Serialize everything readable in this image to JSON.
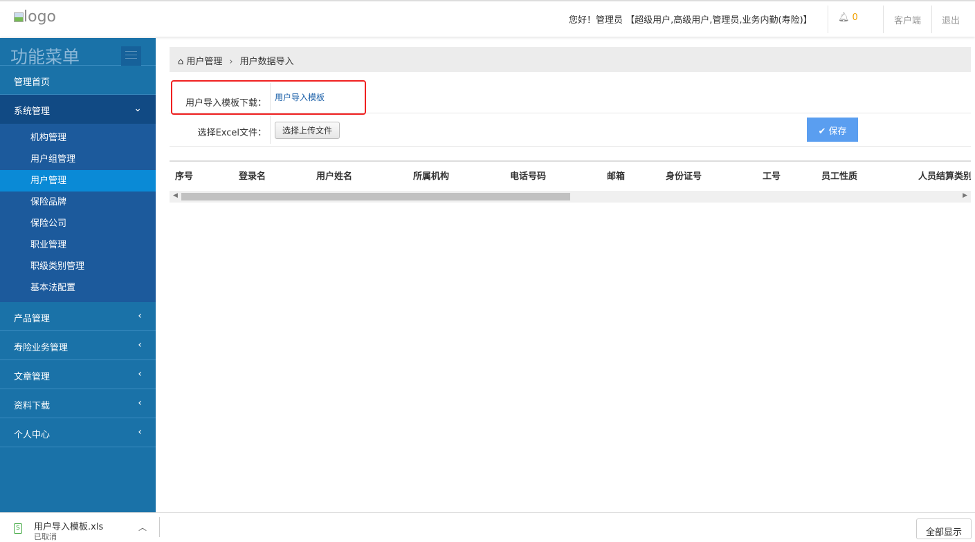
{
  "header": {
    "logo_alt": "logo",
    "greeting": "您好！管理员 【超级用户,高级用户,管理员,业务内勤(寿险)】",
    "notification_count": "0",
    "client_link": "客户端",
    "logout_link": "退出"
  },
  "sidebar": {
    "title": "功能菜单",
    "items": [
      {
        "label": "管理首页"
      },
      {
        "label": "系统管理",
        "children": [
          "机构管理",
          "用户组管理",
          "用户管理",
          "保险品牌",
          "保险公司",
          "职业管理",
          "职级类别管理",
          "基本法配置"
        ]
      },
      {
        "label": "产品管理"
      },
      {
        "label": "寿险业务管理"
      },
      {
        "label": "文章管理"
      },
      {
        "label": "资料下载"
      },
      {
        "label": "个人中心"
      }
    ]
  },
  "breadcrumb": {
    "parent": "用户管理",
    "current": "用户数据导入"
  },
  "form": {
    "template_label": "用户导入模板下载：",
    "template_link": "用户导入模板",
    "file_label": "选择Excel文件：",
    "upload_button": "选择上传文件",
    "save_button": "保存"
  },
  "table": {
    "columns": [
      "序号",
      "登录名",
      "用户姓名",
      "所属机构",
      "电话号码",
      "邮箱",
      "身份证号",
      "工号",
      "员工性质",
      "人员结算类别"
    ]
  },
  "downloads": {
    "file_name": "用户导入模板.xls",
    "status": "已取消",
    "show_all": "全部显示"
  }
}
